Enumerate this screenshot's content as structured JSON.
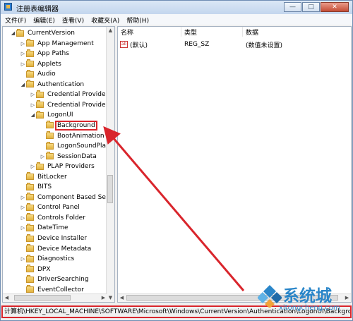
{
  "window": {
    "title": "注册表编辑器",
    "btn_min": "—",
    "btn_max": "□",
    "btn_close": "✕"
  },
  "menu": [
    "文件(F)",
    "编辑(E)",
    "查看(V)",
    "收藏夹(A)",
    "帮助(H)"
  ],
  "tree": [
    {
      "label": "CurrentVersion",
      "arrow": "◢",
      "level": 1
    },
    {
      "label": "App Management",
      "arrow": "▷",
      "level": 2
    },
    {
      "label": "App Paths",
      "arrow": "▷",
      "level": 2
    },
    {
      "label": "Applets",
      "arrow": "▷",
      "level": 2
    },
    {
      "label": "Audio",
      "arrow": "",
      "level": 2
    },
    {
      "label": "Authentication",
      "arrow": "◢",
      "level": 2
    },
    {
      "label": "Credential Provider",
      "arrow": "▷",
      "level": 3
    },
    {
      "label": "Credential Provider",
      "arrow": "▷",
      "level": 3
    },
    {
      "label": "LogonUI",
      "arrow": "◢",
      "level": 3
    },
    {
      "label": "Background",
      "arrow": "",
      "level": 4,
      "selected": true
    },
    {
      "label": "BootAnimation",
      "arrow": "",
      "level": 4
    },
    {
      "label": "LogonSoundPla",
      "arrow": "",
      "level": 4
    },
    {
      "label": "SessionData",
      "arrow": "▷",
      "level": 4
    },
    {
      "label": "PLAP Providers",
      "arrow": "▷",
      "level": 3
    },
    {
      "label": "BitLocker",
      "arrow": "",
      "level": 2
    },
    {
      "label": "BITS",
      "arrow": "",
      "level": 2
    },
    {
      "label": "Component Based Se",
      "arrow": "▷",
      "level": 2
    },
    {
      "label": "Control Panel",
      "arrow": "▷",
      "level": 2
    },
    {
      "label": "Controls Folder",
      "arrow": "▷",
      "level": 2
    },
    {
      "label": "DateTime",
      "arrow": "▷",
      "level": 2
    },
    {
      "label": "Device Installer",
      "arrow": "",
      "level": 2
    },
    {
      "label": "Device Metadata",
      "arrow": "",
      "level": 2
    },
    {
      "label": "Diagnostics",
      "arrow": "▷",
      "level": 2
    },
    {
      "label": "DPX",
      "arrow": "",
      "level": 2
    },
    {
      "label": "DriverSearching",
      "arrow": "",
      "level": 2
    },
    {
      "label": "EventCollector",
      "arrow": "",
      "level": 2
    }
  ],
  "list": {
    "columns": [
      "名称",
      "类型",
      "数据"
    ],
    "rows": [
      {
        "name": "(默认)",
        "type": "REG_SZ",
        "data": "(数值未设置)",
        "icon": "ab"
      }
    ]
  },
  "statusbar": "计算机\\HKEY_LOCAL_MACHINE\\SOFTWARE\\Microsoft\\Windows\\CurrentVersion\\Authentication\\LogonUI\\Background",
  "scroll_glyphs": {
    "up": "▲",
    "down": "▼",
    "left": "◀",
    "right": "▶"
  },
  "watermark": {
    "text": "系统城",
    "url": "xitongcheng.com"
  },
  "colors": {
    "highlight_red": "#d9252c",
    "watermark_blue": "#2a86c9"
  }
}
